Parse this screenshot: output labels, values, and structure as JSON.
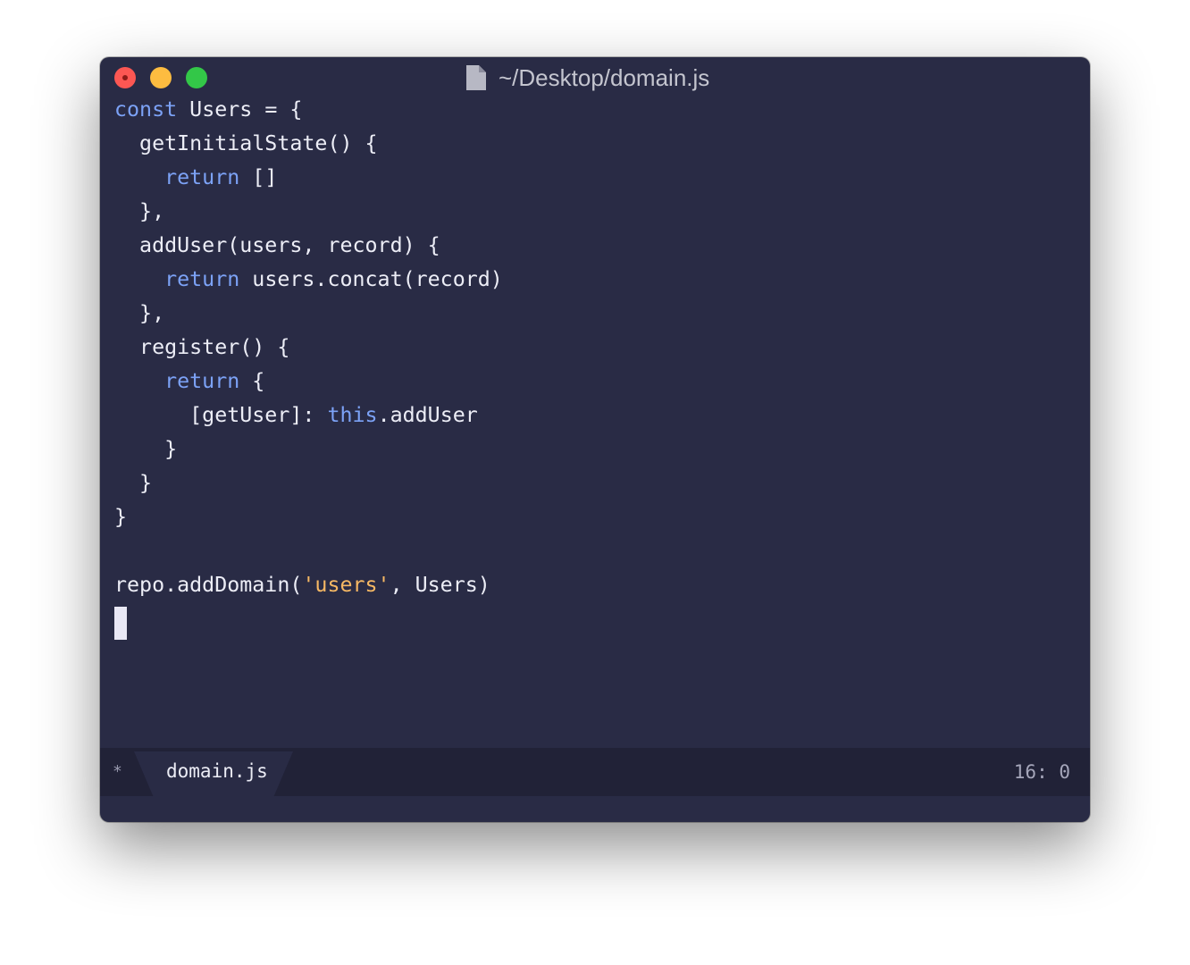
{
  "window": {
    "title": "~/Desktop/domain.js",
    "title_icon": "document-icon"
  },
  "editor": {
    "lines": [
      [
        {
          "t": "const",
          "c": "kw"
        },
        {
          "t": " Users = {",
          "c": ""
        }
      ],
      [
        {
          "t": "  getInitialState() {",
          "c": ""
        }
      ],
      [
        {
          "t": "    ",
          "c": ""
        },
        {
          "t": "return",
          "c": "kw"
        },
        {
          "t": " []",
          "c": ""
        }
      ],
      [
        {
          "t": "  },",
          "c": ""
        }
      ],
      [
        {
          "t": "  addUser(users, record) {",
          "c": ""
        }
      ],
      [
        {
          "t": "    ",
          "c": ""
        },
        {
          "t": "return",
          "c": "kw"
        },
        {
          "t": " users.concat(record)",
          "c": ""
        }
      ],
      [
        {
          "t": "  },",
          "c": ""
        }
      ],
      [
        {
          "t": "  register() {",
          "c": ""
        }
      ],
      [
        {
          "t": "    ",
          "c": ""
        },
        {
          "t": "return",
          "c": "kw"
        },
        {
          "t": " {",
          "c": ""
        }
      ],
      [
        {
          "t": "      [getUser]: ",
          "c": ""
        },
        {
          "t": "this",
          "c": "kw"
        },
        {
          "t": ".addUser",
          "c": ""
        }
      ],
      [
        {
          "t": "    }",
          "c": ""
        }
      ],
      [
        {
          "t": "  }",
          "c": ""
        }
      ],
      [
        {
          "t": "}",
          "c": ""
        }
      ],
      [
        {
          "t": "",
          "c": ""
        }
      ],
      [
        {
          "t": "repo.addDomain(",
          "c": ""
        },
        {
          "t": "'users'",
          "c": "str"
        },
        {
          "t": ", Users)",
          "c": ""
        }
      ]
    ]
  },
  "statusbar": {
    "modified_marker": "*",
    "tab_label": "domain.js",
    "cursor_position": "16: 0"
  },
  "colors": {
    "background": "#292b45",
    "keyword": "#7ca2f6",
    "string": "#f6b864",
    "text": "#ecedf6",
    "statusbar": "#212237"
  }
}
